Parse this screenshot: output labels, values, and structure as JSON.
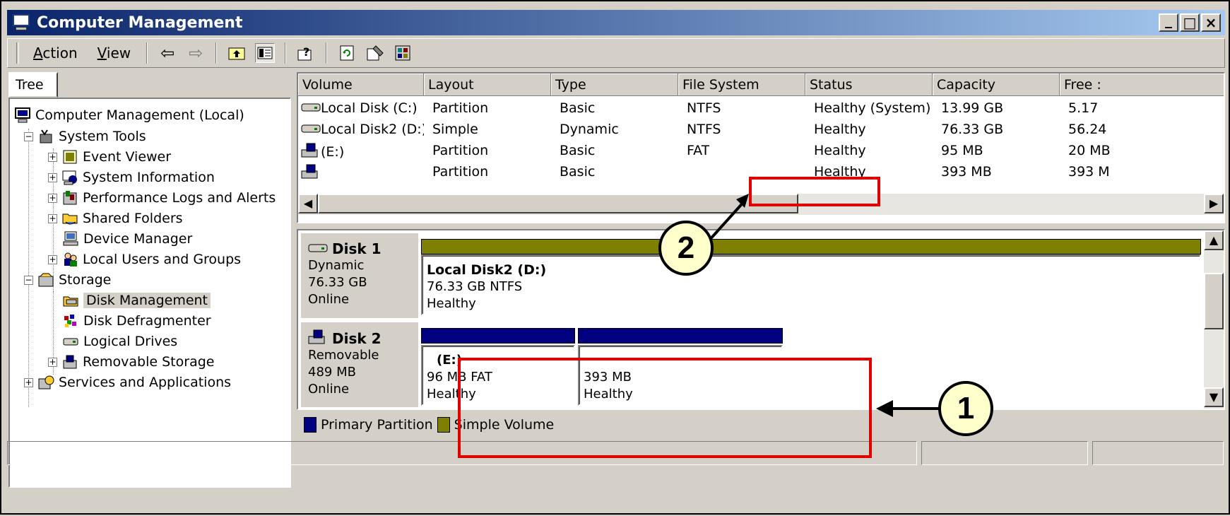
{
  "window": {
    "title": "Computer Management",
    "buttons": {
      "minimize": "_",
      "maximize": "□",
      "close": "×"
    }
  },
  "toolbar": {
    "menus": [
      {
        "label": "Action",
        "accel": "A",
        "rest": "ction"
      },
      {
        "label": "View",
        "accel": "V",
        "rest": "iew"
      }
    ],
    "icons": [
      "back-arrow-icon",
      "forward-arrow-icon",
      "up-folder-icon",
      "show-hide-tree-icon",
      "help-icon",
      "refresh-icon",
      "properties-icon",
      "settings-icon"
    ]
  },
  "tree": {
    "tab_label": "Tree",
    "root": "Computer Management (Local)",
    "items": [
      {
        "label": "System Tools",
        "level": 1,
        "expander": "−"
      },
      {
        "label": "Event Viewer",
        "level": 2,
        "expander": "+"
      },
      {
        "label": "System Information",
        "level": 2,
        "expander": "+"
      },
      {
        "label": "Performance Logs and Alerts",
        "level": 2,
        "expander": "+"
      },
      {
        "label": "Shared Folders",
        "level": 2,
        "expander": "+"
      },
      {
        "label": "Device Manager",
        "level": 2,
        "expander": ""
      },
      {
        "label": "Local Users and Groups",
        "level": 2,
        "expander": "+"
      },
      {
        "label": "Storage",
        "level": 1,
        "expander": "−"
      },
      {
        "label": "Disk Management",
        "level": 2,
        "expander": "",
        "selected": true
      },
      {
        "label": "Disk Defragmenter",
        "level": 2,
        "expander": ""
      },
      {
        "label": "Logical Drives",
        "level": 2,
        "expander": ""
      },
      {
        "label": "Removable Storage",
        "level": 2,
        "expander": "+"
      },
      {
        "label": "Services and Applications",
        "level": 1,
        "expander": "+"
      }
    ]
  },
  "volumes": {
    "columns": [
      "Volume",
      "Layout",
      "Type",
      "File System",
      "Status",
      "Capacity",
      "Free :"
    ],
    "rows": [
      {
        "icon": "hard-disk-icon",
        "volume": "Local Disk (C:)",
        "layout": "Partition",
        "type": "Basic",
        "fs": "NTFS",
        "status": "Healthy (System)",
        "capacity": "13.99 GB",
        "free": "5.17 "
      },
      {
        "icon": "hard-disk-icon",
        "volume": "Local Disk2 (D:)",
        "layout": "Simple",
        "type": "Dynamic",
        "fs": "NTFS",
        "status": "Healthy",
        "capacity": "76.33 GB",
        "free": "56.24"
      },
      {
        "icon": "removable-disk-icon",
        "volume": "(E:)",
        "layout": "Partition",
        "type": "Basic",
        "fs": "FAT",
        "status": "Healthy",
        "capacity": "95 MB",
        "free": "20 MB"
      },
      {
        "icon": "removable-disk-icon",
        "volume": "",
        "layout": "Partition",
        "type": "Basic",
        "fs": "",
        "status": "Healthy",
        "capacity": "393 MB",
        "free": "393 M"
      }
    ]
  },
  "disks": [
    {
      "name": "Disk 1",
      "kind": "Dynamic",
      "size": "76.33 GB",
      "state": "Online",
      "partitions": [
        {
          "title": "Local Disk2  (D:)",
          "line1": "76.33 GB NTFS",
          "line2": "Healthy",
          "color": "#808000"
        }
      ]
    },
    {
      "name": "Disk 2",
      "kind": "Removable",
      "size": "489 MB",
      "state": "Online",
      "partitions": [
        {
          "title": "(E:)",
          "line1": "96 MB FAT",
          "line2": "Healthy",
          "color": "#000080"
        },
        {
          "title": "",
          "line1": "393 MB",
          "line2": "Healthy",
          "color": "#000080"
        }
      ]
    }
  ],
  "legend": [
    {
      "label": "Primary Partition",
      "color": "#000080"
    },
    {
      "label": "Simple Volume",
      "color": "#808000"
    }
  ],
  "callouts": {
    "one": "1",
    "two": "2"
  },
  "colors": {
    "highlight": "#e00000",
    "callout_fill": "#ffffcc",
    "title_start": "#0a246a",
    "title_end": "#a6caf0"
  }
}
